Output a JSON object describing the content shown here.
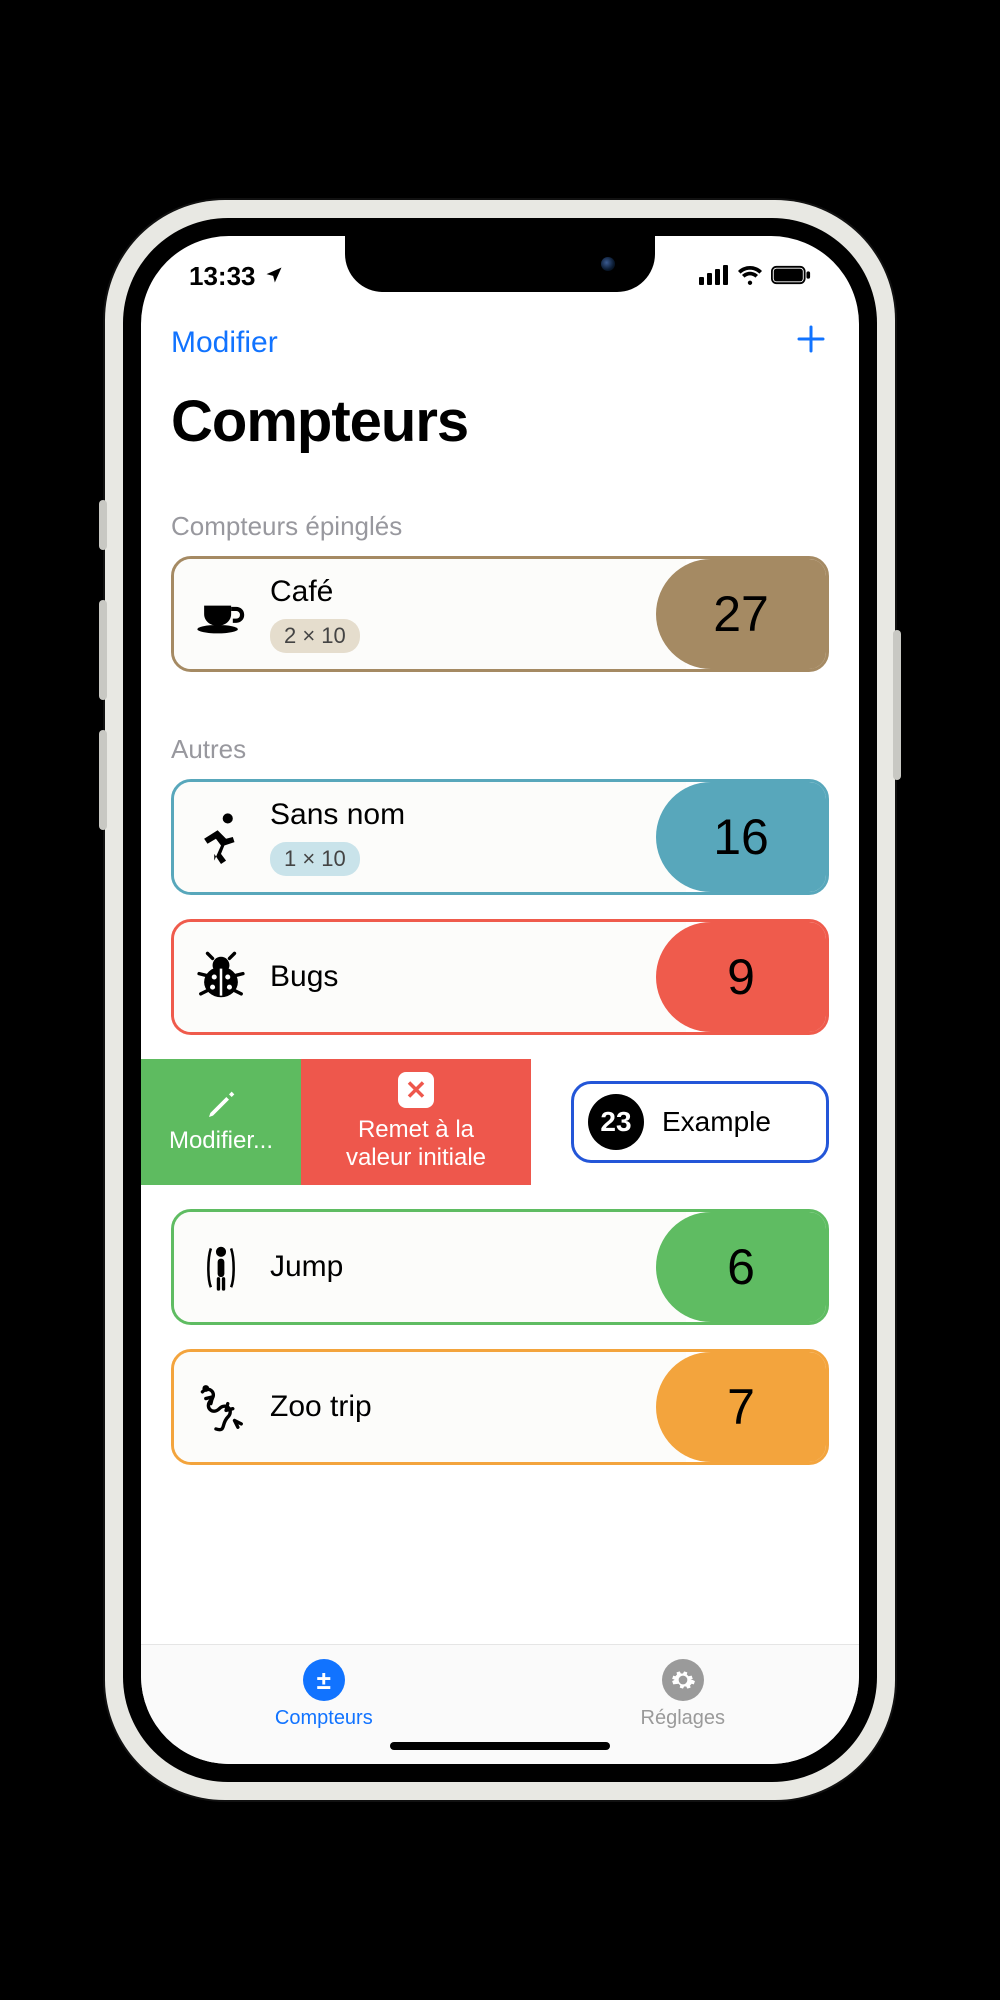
{
  "status": {
    "time": "13:33"
  },
  "nav": {
    "edit": "Modifier",
    "add": "+"
  },
  "title": "Compteurs",
  "sections": {
    "pinned": "Compteurs épinglés",
    "others": "Autres"
  },
  "counters": {
    "cafe": {
      "name": "Café",
      "badge": "2 × 10",
      "count": "27",
      "color": "#a58a63",
      "badgeBg": "#e5ddcd"
    },
    "sansnom": {
      "name": "Sans nom",
      "badge": "1 × 10",
      "count": "16",
      "color": "#58a7bb",
      "badgeBg": "#c9e3ea"
    },
    "bugs": {
      "name": "Bugs",
      "count": "9",
      "color": "#ef5b4c"
    },
    "example": {
      "name": "Example",
      "count": "23",
      "color": "#1856d6"
    },
    "jump": {
      "name": "Jump",
      "count": "6",
      "color": "#5fbc62"
    },
    "zoo": {
      "name": "Zoo trip",
      "count": "7",
      "color": "#f3a43d"
    }
  },
  "swipe": {
    "edit": "Modifier...",
    "reset": "Remet à la\nvaleur initiale"
  },
  "tabs": {
    "counters": "Compteurs",
    "settings": "Réglages"
  }
}
